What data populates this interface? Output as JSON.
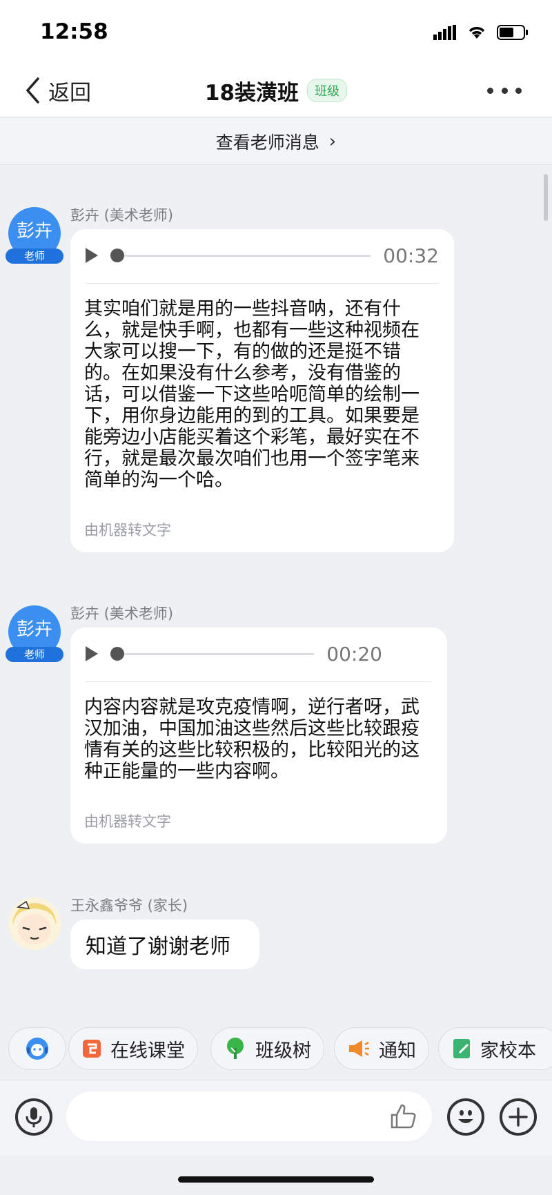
{
  "status_bar": {
    "time": "12:58"
  },
  "nav": {
    "back_label": "返回",
    "title": "18装潢班",
    "badge": "班级"
  },
  "teacher_messages_link": "查看老师消息",
  "messages": [
    {
      "sender": "彭卉 (美术老师)",
      "avatar_text": "彭卉",
      "role_tag": "老师",
      "duration": "00:32",
      "transcript": "其实咱们就是用的一些抖音呐，还有什么，就是快手啊，也都有一些这种视频在大家可以搜一下，有的做的还是挺不错的。在如果没有什么参考，没有借鉴的话，可以借鉴一下这些哈呃简单的绘制一下，用你身边能用的到的工具。如果要是能旁边小店能买着这个彩笔，最好实在不行，就是最次最次咱们也用一个签字笔来简单的沟一个哈。",
      "machine_label": "由机器转文字"
    },
    {
      "sender": "彭卉 (美术老师)",
      "avatar_text": "彭卉",
      "role_tag": "老师",
      "duration": "00:20",
      "transcript": "内容内容就是攻克疫情啊，逆行者呀，武汉加油，中国加油这些然后这些比较跟疫情有关的这些比较积极的，比较阳光的这种正能量的一些内容啊。",
      "machine_label": "由机器转文字"
    },
    {
      "sender": "王永鑫爷爷 (家长)",
      "text": "知道了谢谢老师"
    }
  ],
  "quick_actions": [
    {
      "label": "在线课堂",
      "icon": "online-class-icon",
      "color": "#f2673a"
    },
    {
      "label": "班级树",
      "icon": "class-tree-icon",
      "color": "#39b54a"
    },
    {
      "label": "通知",
      "icon": "megaphone-icon",
      "color": "#f08a24"
    },
    {
      "label": "家校本",
      "icon": "notebook-icon",
      "color": "#3cb371"
    }
  ],
  "colors": {
    "accent_blue": "#3a8ff0",
    "badge_green": "#2eaa55"
  }
}
